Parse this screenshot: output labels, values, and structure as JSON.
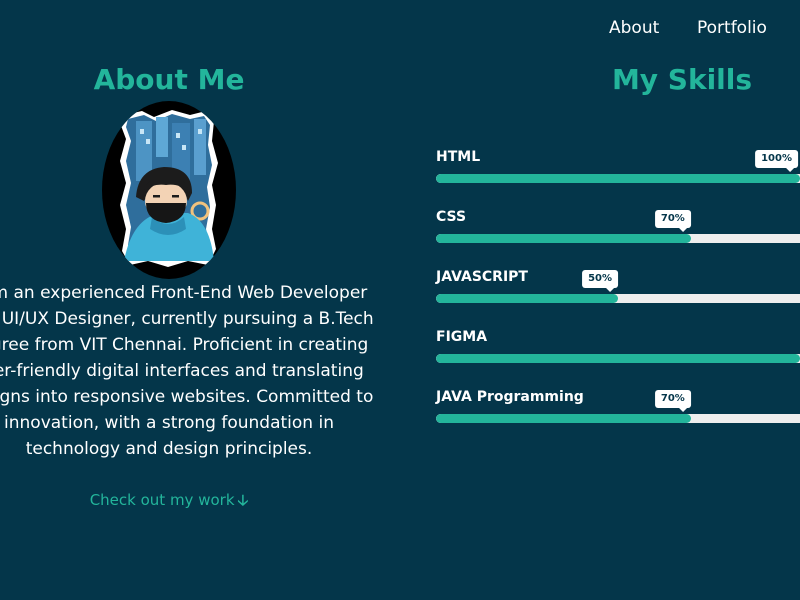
{
  "nav": {
    "about_label": "About",
    "portfolio_label": "Portfolio"
  },
  "about": {
    "title": "About Me",
    "bio": "I am an experienced Front-End Web Developer and UI/UX Designer, currently pursuing a B.Tech degree from VIT Chennai. Proficient in creating user-friendly digital interfaces and translating designs into responsive websites. Committed to innovation, with a strong foundation in technology and design principles.",
    "work_link_label": "Check out my work",
    "work_link_icon": "arrow-down-icon"
  },
  "skills": {
    "title": "My Skills",
    "items": [
      {
        "name": "HTML",
        "percent": 100,
        "tooltip": "100%"
      },
      {
        "name": "CSS",
        "percent": 70,
        "tooltip": "70%"
      },
      {
        "name": "JAVASCRIPT",
        "percent": 50,
        "tooltip": "50%"
      },
      {
        "name": "FIGMA",
        "percent": 100,
        "tooltip": ""
      },
      {
        "name": "JAVA Programming",
        "percent": 70,
        "tooltip": "70%"
      }
    ]
  },
  "colors": {
    "background": "#04364a",
    "accent": "#23b59b",
    "track": "#eeeeee",
    "text": "#ffffff"
  }
}
